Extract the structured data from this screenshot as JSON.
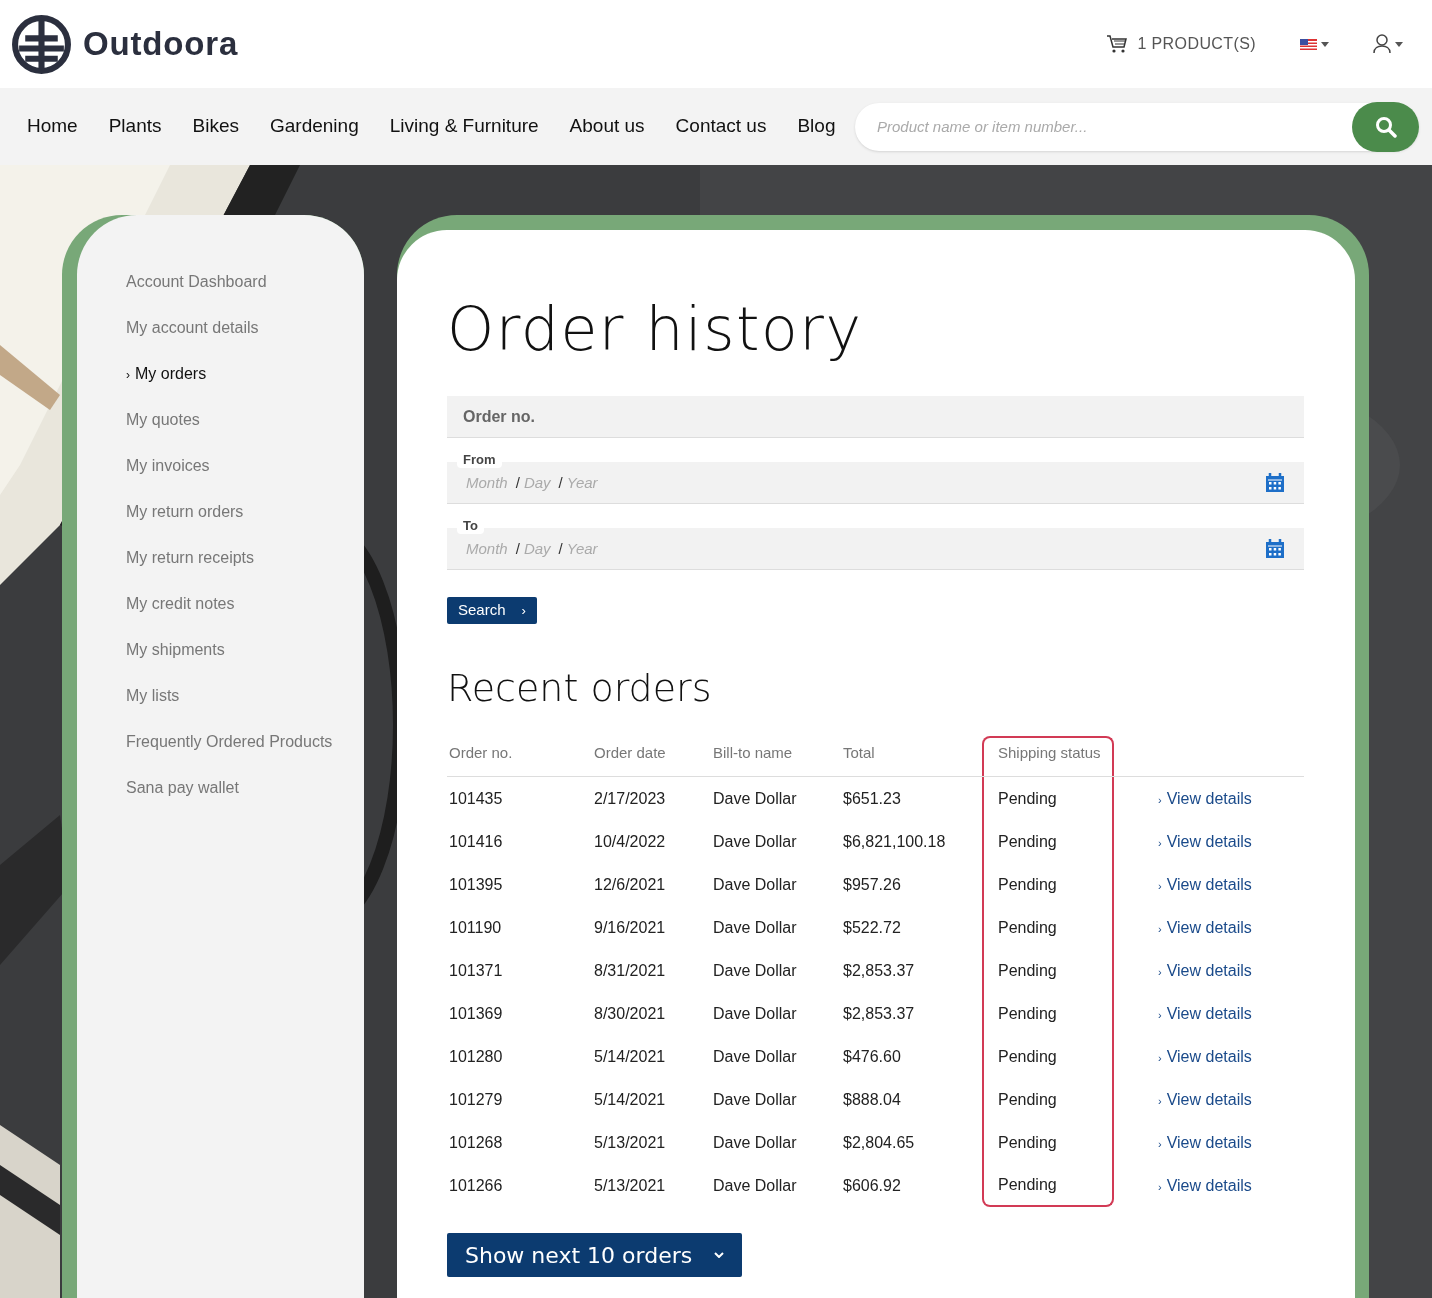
{
  "header": {
    "brand": "Outdoora",
    "cart": {
      "label": "1 PRODUCT(S)"
    }
  },
  "nav": {
    "items": [
      {
        "label": "Home"
      },
      {
        "label": "Plants"
      },
      {
        "label": "Bikes"
      },
      {
        "label": "Gardening"
      },
      {
        "label": "Living & Furniture"
      },
      {
        "label": "About us"
      },
      {
        "label": "Contact us"
      },
      {
        "label": "Blog"
      }
    ],
    "search": {
      "placeholder": "Product name or item number..."
    }
  },
  "sidebar": {
    "items": [
      {
        "label": "Account Dashboard",
        "selected": false
      },
      {
        "label": "My account details",
        "selected": false
      },
      {
        "label": "My orders",
        "selected": true,
        "marker": "›"
      },
      {
        "label": "My quotes",
        "selected": false
      },
      {
        "label": "My invoices",
        "selected": false
      },
      {
        "label": "My return orders",
        "selected": false
      },
      {
        "label": "My return receipts",
        "selected": false
      },
      {
        "label": "My credit notes",
        "selected": false
      },
      {
        "label": "My shipments",
        "selected": false
      },
      {
        "label": "My lists",
        "selected": false
      },
      {
        "label": "Frequently Ordered Products",
        "selected": false
      },
      {
        "label": "Sana pay wallet",
        "selected": false
      }
    ]
  },
  "main": {
    "title": "Order history",
    "order_no_field": {
      "placeholder": "Order no."
    },
    "date_fields": [
      {
        "label": "From",
        "parts": [
          {
            "kind": "placeholder",
            "text": "Month"
          },
          {
            "kind": "separator",
            "text": "/"
          },
          {
            "kind": "placeholder",
            "text": "Day"
          },
          {
            "kind": "separator",
            "text": "/"
          },
          {
            "kind": "placeholder",
            "text": "Year"
          }
        ]
      },
      {
        "label": "To",
        "parts": [
          {
            "kind": "placeholder",
            "text": "Month"
          },
          {
            "kind": "separator",
            "text": "/"
          },
          {
            "kind": "placeholder",
            "text": "Day"
          },
          {
            "kind": "separator",
            "text": "/"
          },
          {
            "kind": "placeholder",
            "text": "Year"
          }
        ]
      }
    ],
    "search_button": {
      "label": "Search",
      "chevron": "›"
    },
    "recent_title": "Recent orders",
    "table": {
      "columns": [
        {
          "label": "Order no.",
          "highlighted": false
        },
        {
          "label": "Order date",
          "highlighted": false
        },
        {
          "label": "Bill-to name",
          "highlighted": false
        },
        {
          "label": "Total",
          "highlighted": false
        },
        {
          "label": "Shipping status",
          "highlighted": true
        }
      ],
      "rows": [
        {
          "cells": [
            "101435",
            "2/17/2023",
            "Dave Dollar",
            "$651.23",
            "Pending"
          ],
          "link": "View details"
        },
        {
          "cells": [
            "101416",
            "10/4/2022",
            "Dave Dollar",
            "$6,821,100.18",
            "Pending"
          ],
          "link": "View details"
        },
        {
          "cells": [
            "101395",
            "12/6/2021",
            "Dave Dollar",
            "$957.26",
            "Pending"
          ],
          "link": "View details"
        },
        {
          "cells": [
            "101190",
            "9/16/2021",
            "Dave Dollar",
            "$522.72",
            "Pending"
          ],
          "link": "View details"
        },
        {
          "cells": [
            "101371",
            "8/31/2021",
            "Dave Dollar",
            "$2,853.37",
            "Pending"
          ],
          "link": "View details"
        },
        {
          "cells": [
            "101369",
            "8/30/2021",
            "Dave Dollar",
            "$2,853.37",
            "Pending"
          ],
          "link": "View details"
        },
        {
          "cells": [
            "101280",
            "5/14/2021",
            "Dave Dollar",
            "$476.60",
            "Pending"
          ],
          "link": "View details"
        },
        {
          "cells": [
            "101279",
            "5/14/2021",
            "Dave Dollar",
            "$888.04",
            "Pending"
          ],
          "link": "View details"
        },
        {
          "cells": [
            "101268",
            "5/13/2021",
            "Dave Dollar",
            "$2,804.65",
            "Pending"
          ],
          "link": "View details"
        },
        {
          "cells": [
            "101266",
            "5/13/2021",
            "Dave Dollar",
            "$606.92",
            "Pending"
          ],
          "link": "View details"
        }
      ],
      "link_marker": "›"
    },
    "show_more_button": {
      "label": "Show next 10 orders"
    }
  }
}
